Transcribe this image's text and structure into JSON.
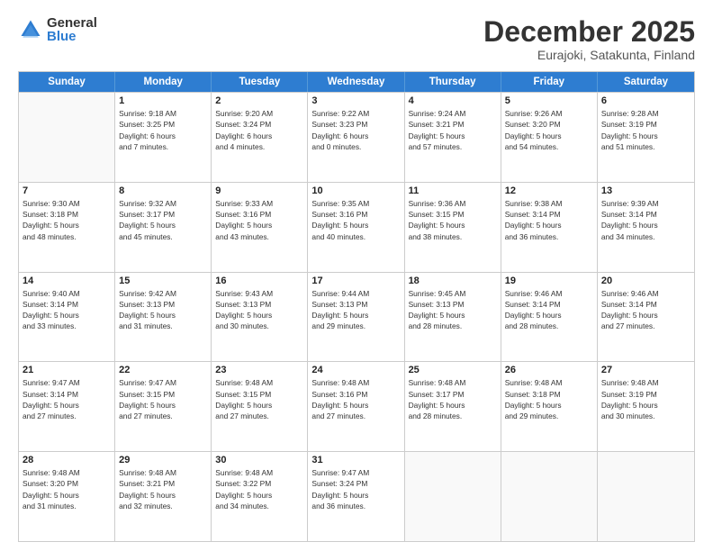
{
  "logo": {
    "general": "General",
    "blue": "Blue"
  },
  "title": {
    "month": "December 2025",
    "location": "Eurajoki, Satakunta, Finland"
  },
  "header_days": [
    "Sunday",
    "Monday",
    "Tuesday",
    "Wednesday",
    "Thursday",
    "Friday",
    "Saturday"
  ],
  "weeks": [
    [
      {
        "day": "",
        "lines": []
      },
      {
        "day": "1",
        "lines": [
          "Sunrise: 9:18 AM",
          "Sunset: 3:25 PM",
          "Daylight: 6 hours",
          "and 7 minutes."
        ]
      },
      {
        "day": "2",
        "lines": [
          "Sunrise: 9:20 AM",
          "Sunset: 3:24 PM",
          "Daylight: 6 hours",
          "and 4 minutes."
        ]
      },
      {
        "day": "3",
        "lines": [
          "Sunrise: 9:22 AM",
          "Sunset: 3:23 PM",
          "Daylight: 6 hours",
          "and 0 minutes."
        ]
      },
      {
        "day": "4",
        "lines": [
          "Sunrise: 9:24 AM",
          "Sunset: 3:21 PM",
          "Daylight: 5 hours",
          "and 57 minutes."
        ]
      },
      {
        "day": "5",
        "lines": [
          "Sunrise: 9:26 AM",
          "Sunset: 3:20 PM",
          "Daylight: 5 hours",
          "and 54 minutes."
        ]
      },
      {
        "day": "6",
        "lines": [
          "Sunrise: 9:28 AM",
          "Sunset: 3:19 PM",
          "Daylight: 5 hours",
          "and 51 minutes."
        ]
      }
    ],
    [
      {
        "day": "7",
        "lines": [
          "Sunrise: 9:30 AM",
          "Sunset: 3:18 PM",
          "Daylight: 5 hours",
          "and 48 minutes."
        ]
      },
      {
        "day": "8",
        "lines": [
          "Sunrise: 9:32 AM",
          "Sunset: 3:17 PM",
          "Daylight: 5 hours",
          "and 45 minutes."
        ]
      },
      {
        "day": "9",
        "lines": [
          "Sunrise: 9:33 AM",
          "Sunset: 3:16 PM",
          "Daylight: 5 hours",
          "and 43 minutes."
        ]
      },
      {
        "day": "10",
        "lines": [
          "Sunrise: 9:35 AM",
          "Sunset: 3:16 PM",
          "Daylight: 5 hours",
          "and 40 minutes."
        ]
      },
      {
        "day": "11",
        "lines": [
          "Sunrise: 9:36 AM",
          "Sunset: 3:15 PM",
          "Daylight: 5 hours",
          "and 38 minutes."
        ]
      },
      {
        "day": "12",
        "lines": [
          "Sunrise: 9:38 AM",
          "Sunset: 3:14 PM",
          "Daylight: 5 hours",
          "and 36 minutes."
        ]
      },
      {
        "day": "13",
        "lines": [
          "Sunrise: 9:39 AM",
          "Sunset: 3:14 PM",
          "Daylight: 5 hours",
          "and 34 minutes."
        ]
      }
    ],
    [
      {
        "day": "14",
        "lines": [
          "Sunrise: 9:40 AM",
          "Sunset: 3:14 PM",
          "Daylight: 5 hours",
          "and 33 minutes."
        ]
      },
      {
        "day": "15",
        "lines": [
          "Sunrise: 9:42 AM",
          "Sunset: 3:13 PM",
          "Daylight: 5 hours",
          "and 31 minutes."
        ]
      },
      {
        "day": "16",
        "lines": [
          "Sunrise: 9:43 AM",
          "Sunset: 3:13 PM",
          "Daylight: 5 hours",
          "and 30 minutes."
        ]
      },
      {
        "day": "17",
        "lines": [
          "Sunrise: 9:44 AM",
          "Sunset: 3:13 PM",
          "Daylight: 5 hours",
          "and 29 minutes."
        ]
      },
      {
        "day": "18",
        "lines": [
          "Sunrise: 9:45 AM",
          "Sunset: 3:13 PM",
          "Daylight: 5 hours",
          "and 28 minutes."
        ]
      },
      {
        "day": "19",
        "lines": [
          "Sunrise: 9:46 AM",
          "Sunset: 3:14 PM",
          "Daylight: 5 hours",
          "and 28 minutes."
        ]
      },
      {
        "day": "20",
        "lines": [
          "Sunrise: 9:46 AM",
          "Sunset: 3:14 PM",
          "Daylight: 5 hours",
          "and 27 minutes."
        ]
      }
    ],
    [
      {
        "day": "21",
        "lines": [
          "Sunrise: 9:47 AM",
          "Sunset: 3:14 PM",
          "Daylight: 5 hours",
          "and 27 minutes."
        ]
      },
      {
        "day": "22",
        "lines": [
          "Sunrise: 9:47 AM",
          "Sunset: 3:15 PM",
          "Daylight: 5 hours",
          "and 27 minutes."
        ]
      },
      {
        "day": "23",
        "lines": [
          "Sunrise: 9:48 AM",
          "Sunset: 3:15 PM",
          "Daylight: 5 hours",
          "and 27 minutes."
        ]
      },
      {
        "day": "24",
        "lines": [
          "Sunrise: 9:48 AM",
          "Sunset: 3:16 PM",
          "Daylight: 5 hours",
          "and 27 minutes."
        ]
      },
      {
        "day": "25",
        "lines": [
          "Sunrise: 9:48 AM",
          "Sunset: 3:17 PM",
          "Daylight: 5 hours",
          "and 28 minutes."
        ]
      },
      {
        "day": "26",
        "lines": [
          "Sunrise: 9:48 AM",
          "Sunset: 3:18 PM",
          "Daylight: 5 hours",
          "and 29 minutes."
        ]
      },
      {
        "day": "27",
        "lines": [
          "Sunrise: 9:48 AM",
          "Sunset: 3:19 PM",
          "Daylight: 5 hours",
          "and 30 minutes."
        ]
      }
    ],
    [
      {
        "day": "28",
        "lines": [
          "Sunrise: 9:48 AM",
          "Sunset: 3:20 PM",
          "Daylight: 5 hours",
          "and 31 minutes."
        ]
      },
      {
        "day": "29",
        "lines": [
          "Sunrise: 9:48 AM",
          "Sunset: 3:21 PM",
          "Daylight: 5 hours",
          "and 32 minutes."
        ]
      },
      {
        "day": "30",
        "lines": [
          "Sunrise: 9:48 AM",
          "Sunset: 3:22 PM",
          "Daylight: 5 hours",
          "and 34 minutes."
        ]
      },
      {
        "day": "31",
        "lines": [
          "Sunrise: 9:47 AM",
          "Sunset: 3:24 PM",
          "Daylight: 5 hours",
          "and 36 minutes."
        ]
      },
      {
        "day": "",
        "lines": []
      },
      {
        "day": "",
        "lines": []
      },
      {
        "day": "",
        "lines": []
      }
    ]
  ]
}
